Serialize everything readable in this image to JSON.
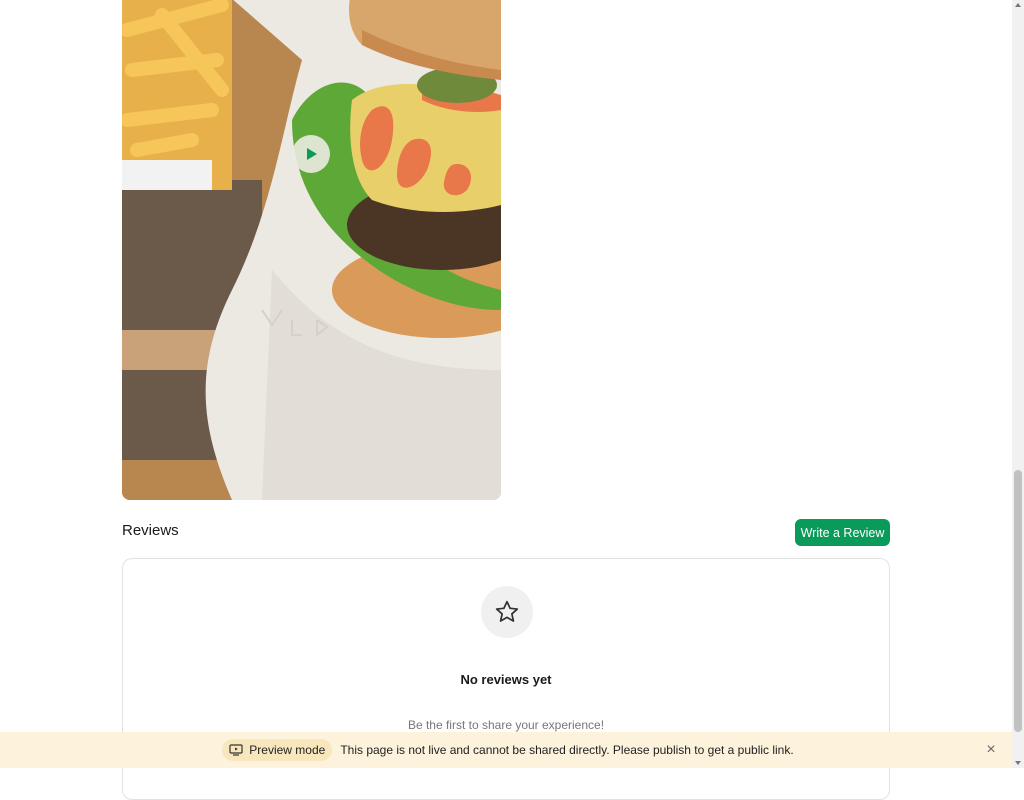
{
  "media": {
    "play_icon": "play-icon",
    "colors": {
      "accent": "#0a9a5a"
    }
  },
  "reviews": {
    "title": "Reviews",
    "write_button": "Write a Review",
    "empty_icon": "star-icon",
    "empty_title": "No reviews yet",
    "empty_subtitle": "Be the first to share your experience!"
  },
  "banner": {
    "mode_label": "Preview mode",
    "mode_icon": "monitor-icon",
    "message": "This page is not live and cannot be shared directly. Please publish to get a public link.",
    "close_icon": "close-icon",
    "close_symbol": "×"
  }
}
